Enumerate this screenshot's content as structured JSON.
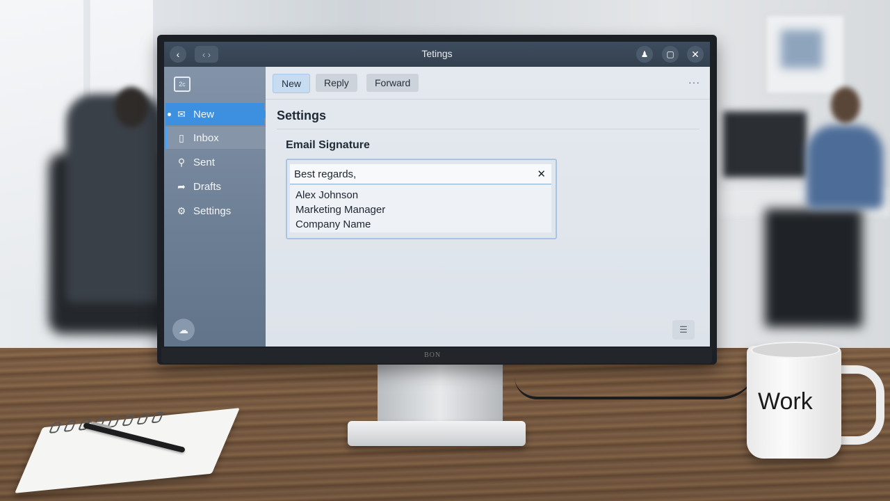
{
  "window": {
    "title": "Tetings"
  },
  "titlebar": {
    "back_icon": "chevron-left-icon",
    "nav_icon": "chevron-pair-icon",
    "action_icon": "user-icon",
    "maximize_icon": "maximize-icon",
    "close_icon": "close-icon"
  },
  "sidebar": {
    "logo_text": "2c",
    "items": [
      {
        "label": "New",
        "icon": "mail-icon",
        "state": "active"
      },
      {
        "label": "Inbox",
        "icon": "inbox-icon",
        "state": "selected"
      },
      {
        "label": "Sent",
        "icon": "search-icon",
        "state": "normal"
      },
      {
        "label": "Drafts",
        "icon": "share-arrow-icon",
        "state": "normal"
      },
      {
        "label": "Settings",
        "icon": "gear-icon",
        "state": "normal"
      }
    ],
    "footer_icon": "cloud-icon"
  },
  "toolbar": {
    "new_label": "New",
    "reply_label": "Reply",
    "forward_label": "Forward",
    "more_label": "···"
  },
  "main": {
    "page_title": "Settings",
    "section_title": "Email Signature",
    "signature": {
      "first_line": "Best regards,",
      "lines": [
        "Alex Johnson",
        "Marketing Manager",
        "Company Name"
      ]
    }
  },
  "scene": {
    "mug_text": "Work",
    "monitor_brand": "BON"
  },
  "colors": {
    "accent": "#3d8fe0",
    "titlebar": "#3d4c5f",
    "sidebar": "#7588a0"
  }
}
